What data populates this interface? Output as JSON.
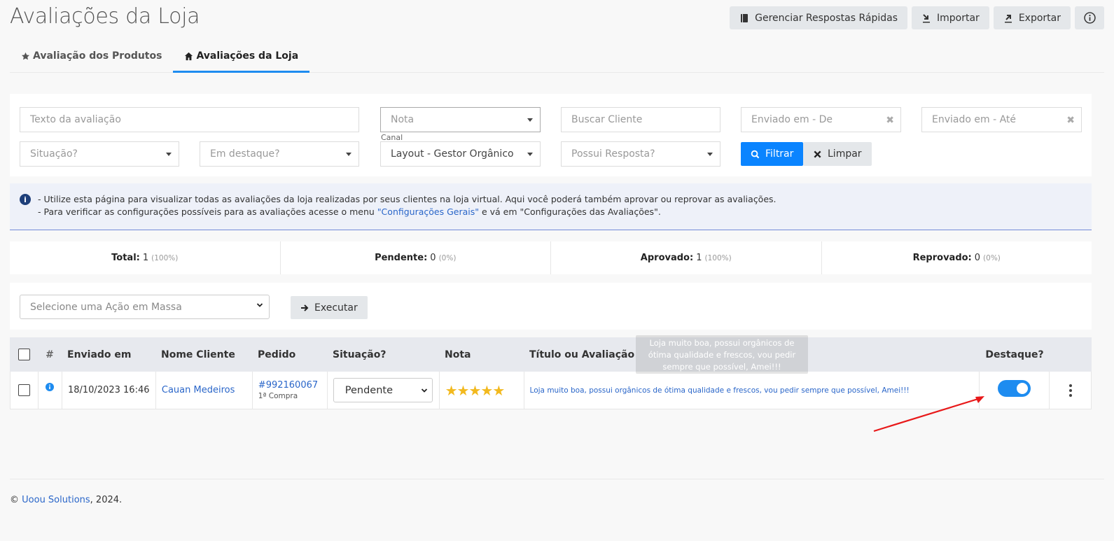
{
  "page": {
    "title": "Avaliações da Loja"
  },
  "top_actions": {
    "quick_replies": "Gerenciar Respostas Rápidas",
    "import": "Importar",
    "export": "Exportar"
  },
  "tabs": [
    {
      "label": "Avaliação dos Produtos",
      "icon": "star-icon",
      "active": false
    },
    {
      "label": "Avaliações da Loja",
      "icon": "home-icon",
      "active": true
    }
  ],
  "filters": {
    "review_text_placeholder": "Texto da avaliação",
    "nota_placeholder": "Nota",
    "cliente_placeholder": "Buscar Cliente",
    "enviado_de_placeholder": "Enviado em - De",
    "enviado_ate_placeholder": "Enviado em - Até",
    "situacao_placeholder": "Situação?",
    "destaque_placeholder": "Em destaque?",
    "canal_label": "Canal",
    "canal_value": "Layout - Gestor Orgânico",
    "resposta_placeholder": "Possui Resposta?",
    "filter_button": "Filtrar",
    "clear_button": "Limpar"
  },
  "info": {
    "line1": "- Utilize esta página para visualizar todas as avaliações da loja realizadas por seus clientes na loja virtual. Aqui você poderá também aprovar ou reprovar as avaliações.",
    "line2_pre": "- Para verificar as configurações possíveis para as avaliações acesse o menu ",
    "line2_link": "\"Configurações Gerais\"",
    "line2_post": " e vá em \"Configurações das Avaliações\"."
  },
  "stats": [
    {
      "label": "Total:",
      "value": "1",
      "pct": "(100%)"
    },
    {
      "label": "Pendente:",
      "value": "0",
      "pct": "(0%)"
    },
    {
      "label": "Aprovado:",
      "value": "1",
      "pct": "(100%)"
    },
    {
      "label": "Reprovado:",
      "value": "0",
      "pct": "(0%)"
    }
  ],
  "mass_action": {
    "select_placeholder": "Selecione uma Ação em Massa",
    "execute_button": "Executar"
  },
  "table": {
    "headers": {
      "hash": "#",
      "sent": "Enviado em",
      "client": "Nome Cliente",
      "order": "Pedido",
      "status": "Situação?",
      "rating": "Nota",
      "review": "Título ou Avaliação",
      "featured": "Destaque?"
    },
    "rows": [
      {
        "sent": "18/10/2023 16:46",
        "client": "Cauan Medeiros",
        "order": "#992160067",
        "order_sub": "1ª Compra",
        "status": "Pendente",
        "stars": "★★★★★",
        "rating": 5,
        "review": "Loja muito boa, possui orgânicos de ótima qualidade e frescos, vou pedir sempre que possível, Amei!!!",
        "featured": true
      }
    ]
  },
  "tooltip": "Loja muito boa, possui orgânicos de ótima qualidade e frescos, vou pedir sempre que possível, Amei!!!",
  "footer": {
    "copyright": "©",
    "company": "Uoou Solutions",
    "year": ", 2024."
  },
  "colors": {
    "accent": "#1e8cf0",
    "primary_button": "#0a84ff",
    "star": "#f2b91e",
    "link": "#2a66c9",
    "arrow": "#e8191a"
  }
}
